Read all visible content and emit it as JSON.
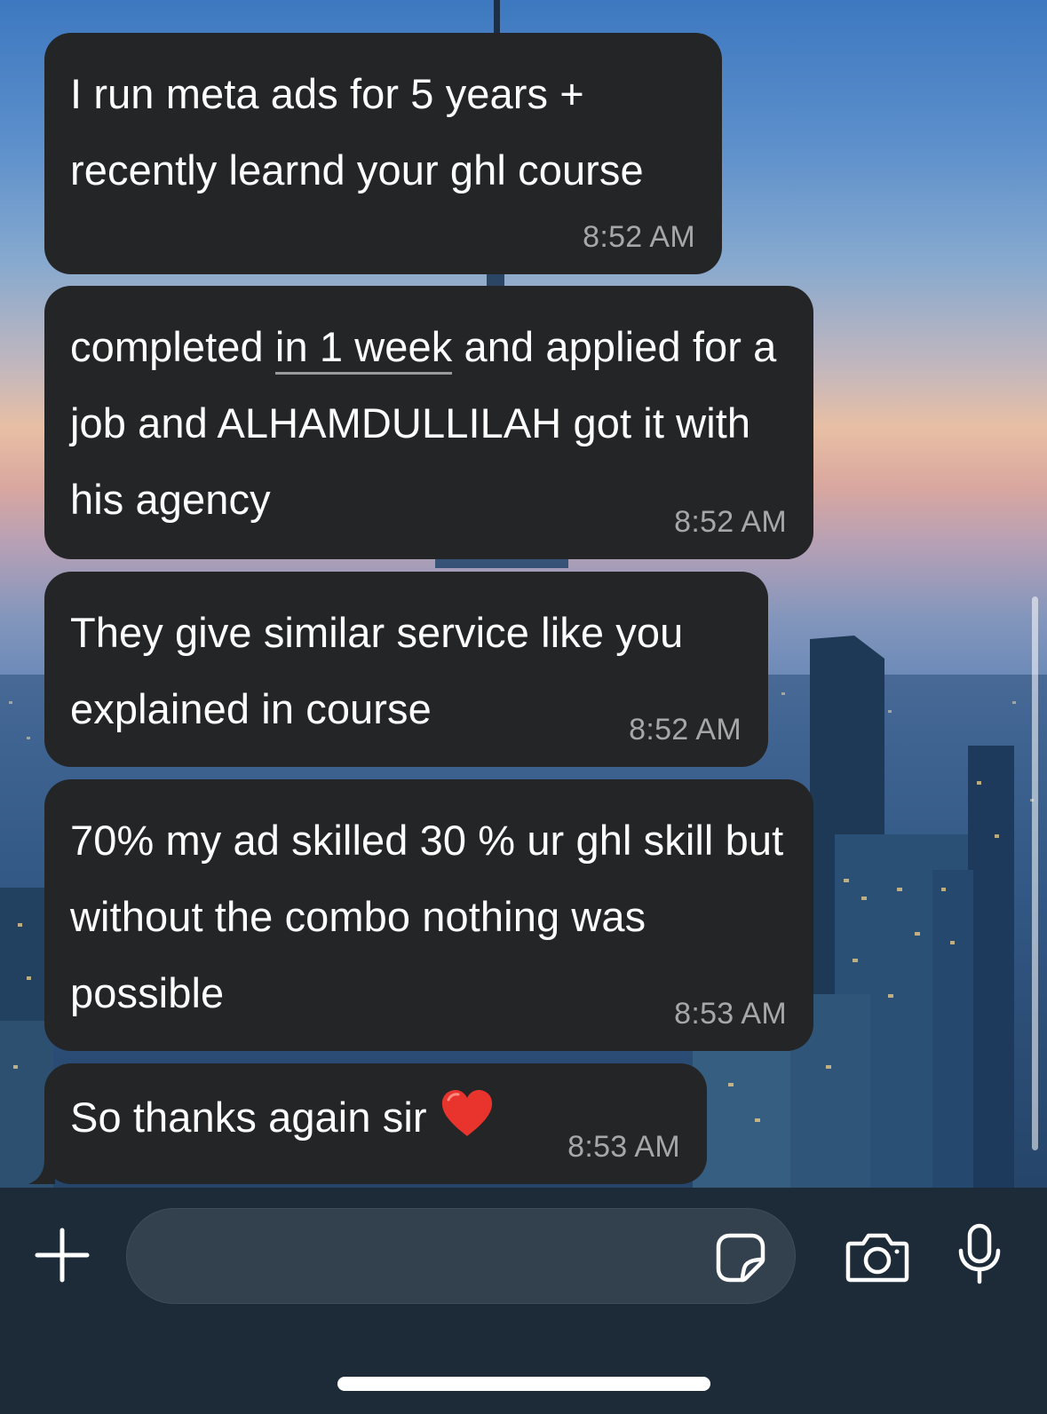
{
  "messages": [
    {
      "text": "I run meta ads for 5 years + recently learnd your ghl course",
      "time": "8:52 AM"
    },
    {
      "text_before": "completed ",
      "text_linked": "in 1 week",
      "text_after": " and applied for a job and ALHAMDULLILAH got it with his agency",
      "time": "8:52 AM"
    },
    {
      "text": "They give similar service like you explained in course",
      "time": "8:52 AM"
    },
    {
      "text": "70% my ad skilled 30 % ur ghl skill but without the combo nothing was possible",
      "time": "8:53 AM"
    },
    {
      "text": "So thanks again sir",
      "emoji": "red-heart",
      "time": "8:53 AM"
    }
  ],
  "composer": {
    "value": "",
    "icons": [
      "plus-icon",
      "sticker-icon",
      "camera-icon",
      "microphone-icon"
    ]
  },
  "colors": {
    "bubble": "#242526",
    "bubble_text": "#ffffff",
    "timestamp": "#a7a7a7",
    "input_bar": "#1d2b38"
  }
}
